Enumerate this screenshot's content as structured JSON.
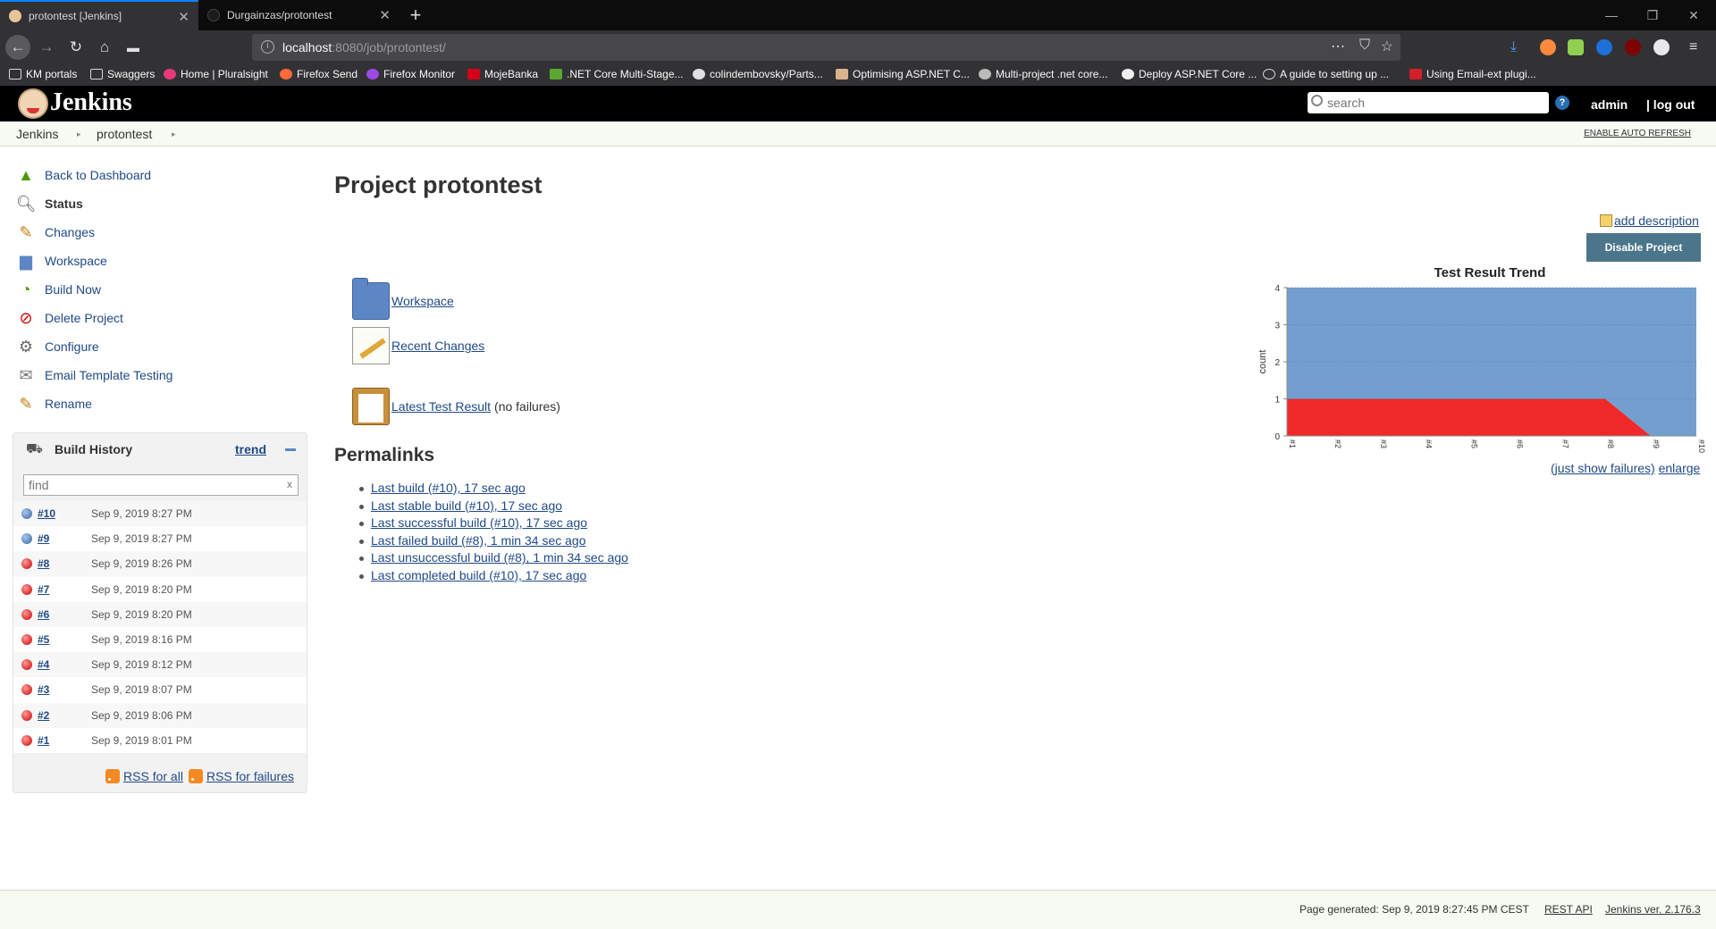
{
  "browser": {
    "tabs": [
      {
        "title": "protontest [Jenkins]",
        "active": true
      },
      {
        "title": "Durgainzas/protontest",
        "active": false
      }
    ],
    "url_host": "localhost",
    "url_port_path": ":8080/job/protontest/",
    "bookmarks": [
      "KM portals",
      "Swaggers",
      "Home | Pluralsight",
      "Firefox Send",
      "Firefox Monitor",
      "MojeBanka",
      ".NET Core Multi-Stage...",
      "colindembovsky/Parts...",
      "Optimising ASP.NET C...",
      "Multi-project .net core...",
      "Deploy ASP.NET Core ...",
      "A guide to setting up ...",
      "Using Email-ext plugi..."
    ]
  },
  "jenkins": {
    "title": "Jenkins",
    "search_placeholder": "search",
    "user": "admin",
    "logout": "| log out"
  },
  "breadcrumb": {
    "items": [
      "Jenkins",
      "protontest"
    ],
    "auto_refresh": "ENABLE AUTO REFRESH"
  },
  "sidebar": {
    "tasks": [
      {
        "label": "Back to Dashboard",
        "icon": "up-arrow-icon"
      },
      {
        "label": "Status",
        "icon": "magnifier-icon"
      },
      {
        "label": "Changes",
        "icon": "notepad-icon"
      },
      {
        "label": "Workspace",
        "icon": "folder-icon"
      },
      {
        "label": "Build Now",
        "icon": "clock-play-icon"
      },
      {
        "label": "Delete Project",
        "icon": "no-entry-icon"
      },
      {
        "label": "Configure",
        "icon": "gear-icon"
      },
      {
        "label": "Email Template Testing",
        "icon": "envelope-icon"
      },
      {
        "label": "Rename",
        "icon": "notepad-pencil-icon"
      }
    ]
  },
  "build_history": {
    "title": "Build History",
    "trend": "trend",
    "filter_placeholder": "find",
    "filter_clear": "x",
    "builds": [
      {
        "num": "#10",
        "date": "Sep 9, 2019 8:27 PM",
        "status": "success"
      },
      {
        "num": "#9",
        "date": "Sep 9, 2019 8:27 PM",
        "status": "success"
      },
      {
        "num": "#8",
        "date": "Sep 9, 2019 8:26 PM",
        "status": "failed"
      },
      {
        "num": "#7",
        "date": "Sep 9, 2019 8:20 PM",
        "status": "failed"
      },
      {
        "num": "#6",
        "date": "Sep 9, 2019 8:20 PM",
        "status": "failed"
      },
      {
        "num": "#5",
        "date": "Sep 9, 2019 8:16 PM",
        "status": "failed"
      },
      {
        "num": "#4",
        "date": "Sep 9, 2019 8:12 PM",
        "status": "failed"
      },
      {
        "num": "#3",
        "date": "Sep 9, 2019 8:07 PM",
        "status": "failed"
      },
      {
        "num": "#2",
        "date": "Sep 9, 2019 8:06 PM",
        "status": "failed"
      },
      {
        "num": "#1",
        "date": "Sep 9, 2019 8:01 PM",
        "status": "failed"
      }
    ],
    "rss_all": "RSS for all",
    "rss_failures": "RSS for failures"
  },
  "main": {
    "title": "Project protontest",
    "add_description": "add description",
    "disable_button": "Disable Project",
    "links": {
      "workspace": "Workspace",
      "recent_changes": "Recent Changes",
      "latest_test": "Latest Test Result",
      "latest_test_note": "(no failures)"
    },
    "permalinks_title": "Permalinks",
    "permalinks": [
      "Last build (#10), 17 sec ago",
      "Last stable build (#10), 17 sec ago",
      "Last successful build (#10), 17 sec ago",
      "Last failed build (#8), 1 min 34 sec ago",
      "Last unsuccessful build (#8), 1 min 34 sec ago",
      "Last completed build (#10), 17 sec ago"
    ],
    "chart_links": {
      "just_failures": "(just show failures)",
      "enlarge": "enlarge"
    }
  },
  "chart_data": {
    "type": "area",
    "title": "Test Result Trend",
    "xlabel": "",
    "ylabel": "count",
    "categories": [
      "#1",
      "#2",
      "#3",
      "#4",
      "#5",
      "#6",
      "#7",
      "#8",
      "#9",
      "#10"
    ],
    "ylim": [
      0,
      4
    ],
    "yticks": [
      0,
      1,
      2,
      3,
      4
    ],
    "stacked": true,
    "series": [
      {
        "values": [
          1,
          1,
          1,
          1,
          1,
          1,
          1,
          1,
          0,
          0
        ],
        "color": "#ef2929"
      },
      {
        "values": [
          3,
          3,
          3,
          3,
          3,
          3,
          3,
          3,
          4,
          4
        ],
        "color": "#729fcf"
      }
    ]
  },
  "footer": {
    "generated": "Page generated: Sep 9, 2019 8:27:45 PM CEST",
    "rest_api": "REST API",
    "version": "Jenkins ver. 2.176.3"
  }
}
